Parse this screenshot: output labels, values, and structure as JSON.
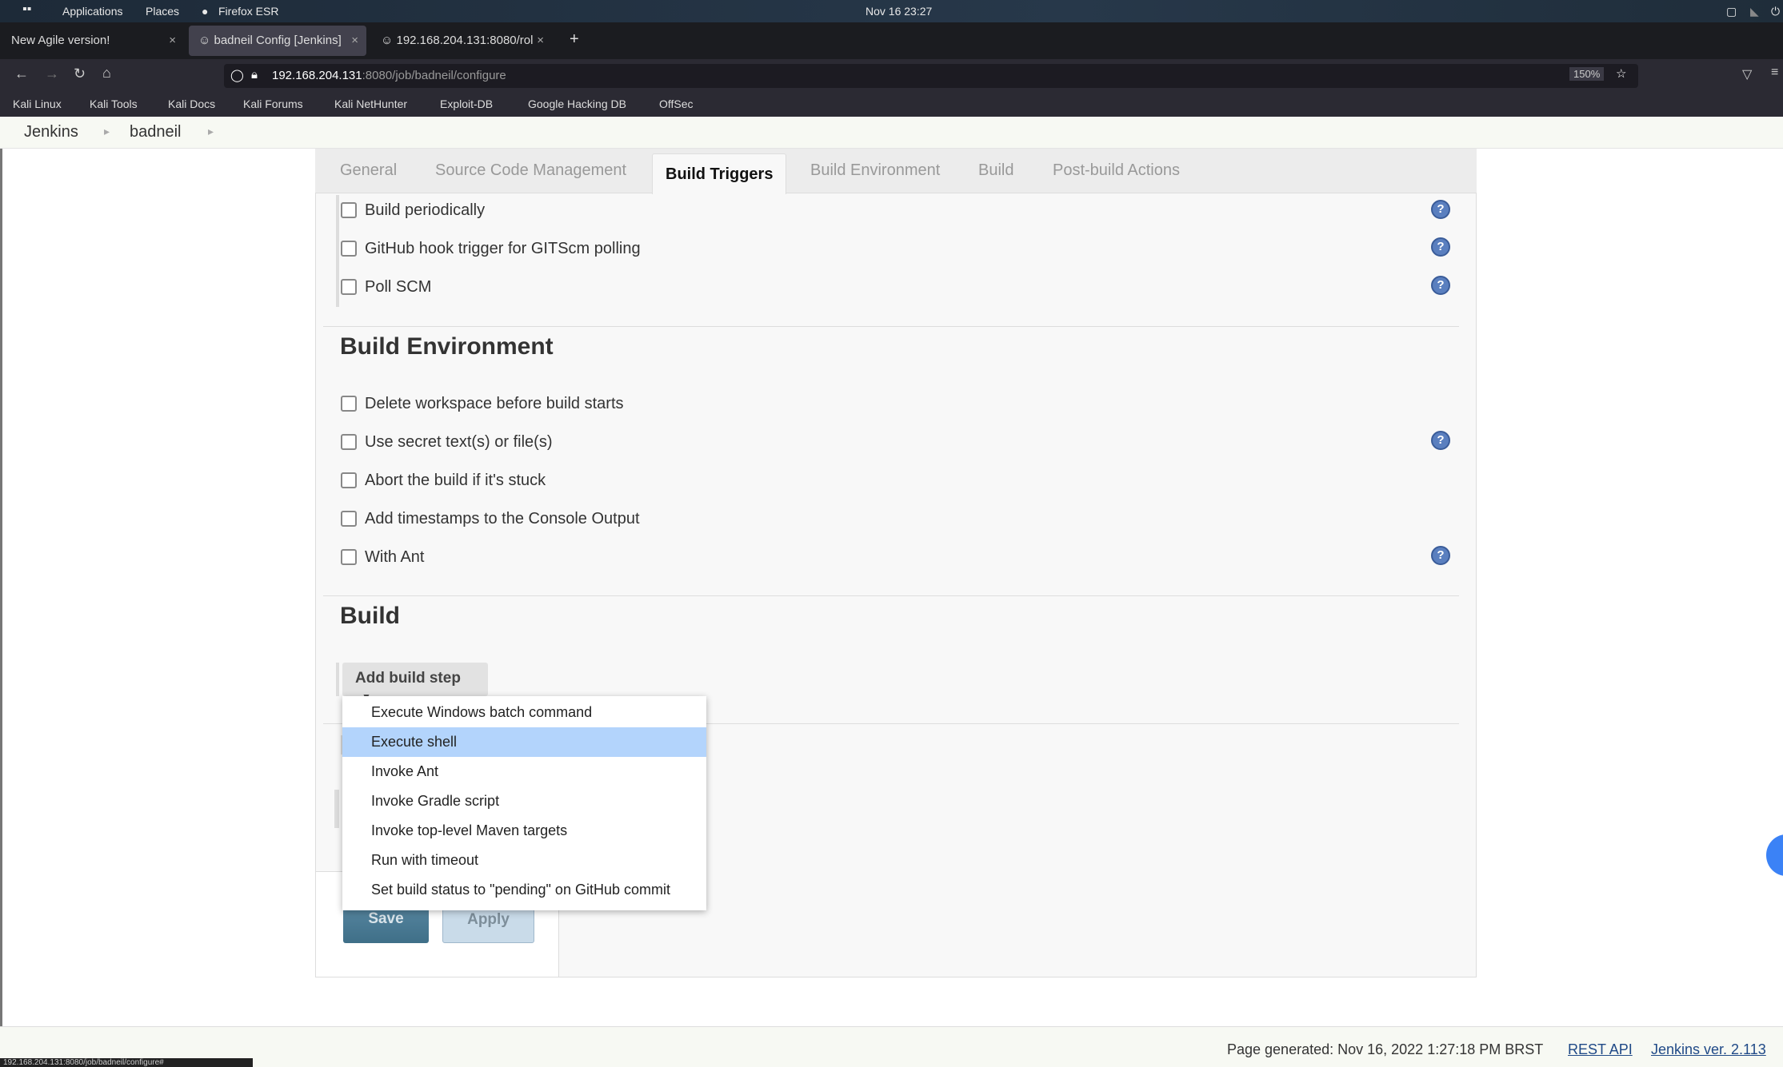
{
  "desktop": {
    "applications": "Applications",
    "places": "Places",
    "browser": "Firefox ESR",
    "clock": "Nov 16  23:27"
  },
  "browser": {
    "tabs": [
      {
        "label": "New Agile version!"
      },
      {
        "label": "badneil Config [Jenkins]",
        "active": true
      },
      {
        "label": "192.168.204.131:8080/rol"
      }
    ],
    "url_host": "192.168.204.131",
    "url_rest": ":8080/job/badneil/configure",
    "zoom": "150%",
    "bookmarks": [
      "Kali Linux",
      "Kali Tools",
      "Kali Docs",
      "Kali Forums",
      "Kali NetHunter",
      "Exploit-DB",
      "Google Hacking DB",
      "OffSec"
    ],
    "status_url": "192.168.204.131:8080/job/badneil/configure#"
  },
  "breadcrumb": [
    "Jenkins",
    "badneil"
  ],
  "config_tabs": [
    "General",
    "Source Code Management",
    "Build Triggers",
    "Build Environment",
    "Build",
    "Post-build Actions"
  ],
  "build_triggers": [
    {
      "label": "Build periodically",
      "checked": false,
      "help": true
    },
    {
      "label": "GitHub hook trigger for GITScm polling",
      "checked": false,
      "help": true
    },
    {
      "label": "Poll SCM",
      "checked": false,
      "help": true
    }
  ],
  "build_environment": {
    "title": "Build Environment",
    "options": [
      {
        "label": "Delete workspace before build starts",
        "checked": false,
        "help": false
      },
      {
        "label": "Use secret text(s) or file(s)",
        "checked": false,
        "help": true
      },
      {
        "label": "Abort the build if it's stuck",
        "checked": false,
        "help": false
      },
      {
        "label": "Add timestamps to the Console Output",
        "checked": false,
        "help": false
      },
      {
        "label": "With Ant",
        "checked": false,
        "help": true
      }
    ]
  },
  "build": {
    "title": "Build",
    "add_step_label": "Add build step",
    "menu_items": [
      "Execute Windows batch command",
      "Execute shell",
      "Invoke Ant",
      "Invoke Gradle script",
      "Invoke top-level Maven targets",
      "Run with timeout",
      "Set build status to \"pending\" on GitHub commit"
    ],
    "highlighted": "Execute shell"
  },
  "actions": {
    "save": "Save",
    "apply": "Apply"
  },
  "footer": {
    "generated": "Page generated: Nov 16, 2022 1:27:18 PM BRST",
    "rest_api": "REST API",
    "version": "Jenkins ver. 2.113"
  }
}
